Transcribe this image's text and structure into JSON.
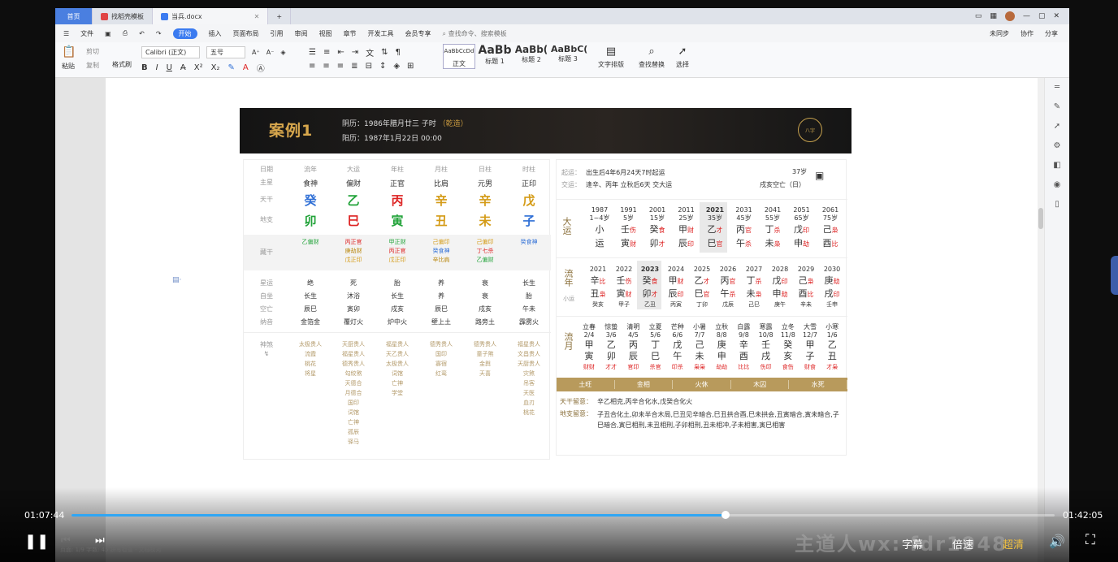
{
  "tabs": [
    "首页",
    "找稻壳模板",
    "当兵.docx"
  ],
  "menu": [
    "文件",
    "开始",
    "插入",
    "页面布局",
    "引用",
    "审阅",
    "视图",
    "章节",
    "开发工具",
    "会员专享",
    "查找命令、搜索模板"
  ],
  "menu_right": [
    "未同步",
    "协作",
    "分享"
  ],
  "ribbon": {
    "paste": "粘贴",
    "cut": "剪切",
    "copy": "复制",
    "fmt": "格式刷",
    "font": "Calibri (正文)",
    "size": "五号",
    "styles": [
      "AaBbCcDd",
      "AaBb",
      "AaBb(",
      "AaBbC("
    ],
    "style_names": [
      "正文",
      "标题 1",
      "标题 2",
      "标题 3"
    ],
    "wenzi": "文字排版",
    "find": "查找替换",
    "select": "选择"
  },
  "banner": {
    "title": "案例1",
    "lunar": "阴历：1986年腊月廿三 子时",
    "lunar_tag": "（乾造）",
    "solar": "阳历：1987年1月22日 00:00",
    "logo": "八字"
  },
  "bazi": {
    "row_labels": [
      "日期",
      "主星",
      "天干",
      "地支",
      "藏干",
      "星运",
      "自坐",
      "空亡",
      "纳音",
      "神煞"
    ],
    "cols": [
      "流年",
      "大运",
      "年柱",
      "月柱",
      "日柱",
      "时柱"
    ],
    "zhuxing": [
      "食神",
      "偏财",
      "正官",
      "比肩",
      "元男",
      "正印"
    ],
    "gan": [
      "癸",
      "乙",
      "丙",
      "辛",
      "辛",
      "戊"
    ],
    "gan_colors": [
      "#2f6fd6",
      "#22a33a",
      "#d22",
      "#d49b16",
      "#d49b16",
      "#d49b16"
    ],
    "zhi": [
      "卯",
      "巳",
      "寅",
      "丑",
      "未",
      "子"
    ],
    "zhi_colors": [
      "#22a33a",
      "#d22",
      "#22a33a",
      "#d49b16",
      "#d49b16",
      "#2f6fd6"
    ],
    "canggan": [
      [
        "乙偏财"
      ],
      [
        "丙正官",
        "庚劫财",
        "戊正印"
      ],
      [
        "甲正财",
        "丙正官",
        "戊正印"
      ],
      [
        "己偏印",
        "癸食神",
        "辛比肩"
      ],
      [
        "己偏印",
        "丁七杀",
        "乙偏财"
      ],
      [
        "癸食神"
      ]
    ],
    "xingyun": [
      "绝",
      "死",
      "胎",
      "养",
      "衰",
      "长生"
    ],
    "zizuo": [
      "长生",
      "沐浴",
      "长生",
      "养",
      "衰",
      "胎"
    ],
    "kongwang": [
      "辰巳",
      "寅卯",
      "戌亥",
      "辰巳",
      "戌亥",
      "午未"
    ],
    "nayin": [
      "金箔金",
      "覆灯火",
      "炉中火",
      "壁上土",
      "路旁土",
      "霹雳火"
    ],
    "shensha": [
      [
        "太极贵人",
        "流霞",
        "桃花",
        "将星"
      ],
      [
        "天厨贵人",
        "福星贵人",
        "德秀贵人",
        "勾绞煞",
        "天德合",
        "月德合",
        "国印",
        "词馆",
        "亡神",
        "孤辰",
        "驿马"
      ],
      [
        "福星贵人",
        "天乙贵人",
        "太极贵人",
        "词馆",
        "亡神",
        "学堂"
      ],
      [
        "德秀贵人",
        "国印",
        "寡宿",
        "红鸾"
      ],
      [
        "德秀贵人",
        "童子煞",
        "金舆",
        "天喜"
      ],
      [
        "福星贵人",
        "文昌贵人",
        "天厨贵人",
        "灾煞",
        "吊客",
        "天医",
        "血刃",
        "桃花"
      ]
    ],
    "shensha_label2": "神煞"
  },
  "qiyun": {
    "l1": "起运：",
    "v1": "出生后4年6月24天7时起运",
    "l2": "交运：",
    "v2": "逢辛、丙年 立秋后6天 交大运",
    "age": "37岁",
    "kw": "戌亥空亡（日）"
  },
  "dayun": {
    "label": "大运",
    "years": [
      "1987",
      "1991",
      "2001",
      "2011",
      "2021",
      "2031",
      "2041",
      "2051",
      "2061"
    ],
    "ages": [
      "1~4岁",
      "5岁",
      "15岁",
      "25岁",
      "35岁",
      "45岁",
      "55岁",
      "65岁",
      "75岁"
    ],
    "g": [
      "小",
      "壬",
      "癸",
      "甲",
      "乙",
      "丙",
      "丁",
      "戊",
      "己"
    ],
    "gs": [
      "",
      "伤",
      "食",
      "财",
      "才",
      "官",
      "杀",
      "印",
      "枭"
    ],
    "z": [
      "运",
      "寅",
      "卯",
      "辰",
      "巳",
      "午",
      "未",
      "申",
      "酉"
    ],
    "zs": [
      "",
      "财",
      "才",
      "印",
      "官",
      "杀",
      "枭",
      "劫",
      "比"
    ]
  },
  "liunian": {
    "label": "流年",
    "sub": "小运",
    "years": [
      "2021",
      "2022",
      "2023",
      "2024",
      "2025",
      "2026",
      "2027",
      "2028",
      "2029",
      "2030"
    ],
    "g": [
      "辛",
      "壬",
      "癸",
      "甲",
      "乙",
      "丙",
      "丁",
      "戊",
      "己",
      "庚"
    ],
    "gs": [
      "比",
      "伤",
      "食",
      "财",
      "才",
      "官",
      "杀",
      "印",
      "枭",
      "劫"
    ],
    "z": [
      "丑",
      "寅",
      "卯",
      "辰",
      "巳",
      "午",
      "未",
      "申",
      "酉",
      "戌"
    ],
    "zs": [
      "枭",
      "财",
      "才",
      "印",
      "官",
      "杀",
      "枭",
      "劫",
      "比",
      "印"
    ],
    "x": [
      "癸亥",
      "甲子",
      "乙丑",
      "丙寅",
      "丁卯",
      "戊辰",
      "己巳",
      "庚午",
      "辛未",
      "壬申"
    ]
  },
  "liuyue": {
    "label": "流月",
    "jie": [
      "立春",
      "惊蛰",
      "清明",
      "立夏",
      "芒种",
      "小暑",
      "立秋",
      "白露",
      "寒露",
      "立冬",
      "大雪",
      "小寒"
    ],
    "dates": [
      "2/4",
      "3/6",
      "4/5",
      "5/6",
      "6/6",
      "7/7",
      "8/8",
      "9/8",
      "10/8",
      "11/8",
      "12/7",
      "1/6"
    ],
    "g": [
      "甲",
      "乙",
      "丙",
      "丁",
      "戊",
      "己",
      "庚",
      "辛",
      "壬",
      "癸",
      "甲",
      "乙"
    ],
    "z": [
      "寅",
      "卯",
      "辰",
      "巳",
      "午",
      "未",
      "申",
      "酉",
      "戌",
      "亥",
      "子",
      "丑"
    ],
    "ss": [
      "财财",
      "才才",
      "官印",
      "杀官",
      "印杀",
      "枭枭",
      "劫劫",
      "比比",
      "伤印",
      "食伤",
      "财食",
      "才枭"
    ]
  },
  "wuxing_bar": [
    "土旺",
    "金相",
    "火休",
    "木囚",
    "水死"
  ],
  "notes": {
    "l1": "天干留意：",
    "v1": "辛乙相克,丙辛合化水,戊癸合化火",
    "l2": "地支留意：",
    "v2": "子丑合化土,卯未半合木局,巳丑见辛暗合,巳丑拱合酉,巳未拱会,丑寅暗合,寅未暗合,子巳暗合,寅巳相刑,未丑相刑,子卯相刑,丑未相冲,子未相害,寅巳相害"
  },
  "player": {
    "current": "01:07:44",
    "duration": "01:42:05",
    "progress": 0.665,
    "subtitle": "字幕",
    "speed": "倍速",
    "quality": "超清",
    "watermark": "主道人wx: fdr1948"
  },
  "status": "页面: 1/9   字数: 45   拼写检查 ·  文档校对"
}
